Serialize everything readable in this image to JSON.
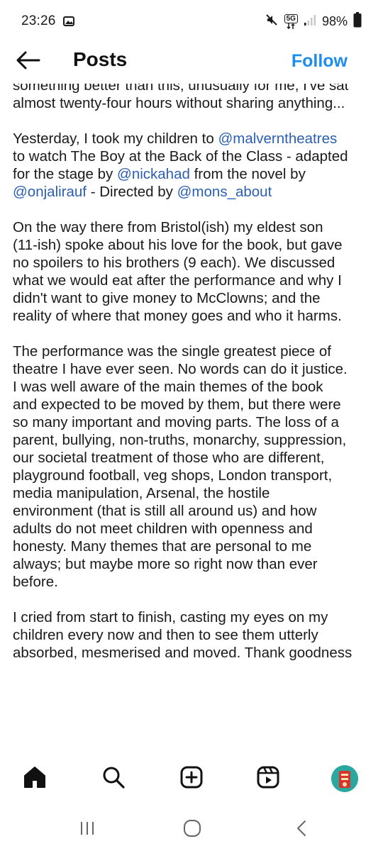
{
  "status_bar": {
    "time": "23:26",
    "battery": "98%",
    "network": "5G",
    "icons": [
      "gallery-icon",
      "mute-icon",
      "network-5g-icon",
      "signal-icon",
      "battery-icon"
    ]
  },
  "header": {
    "title": "Posts",
    "follow_label": "Follow",
    "back_icon": "arrow-left-icon",
    "accent_color": "#1d8ef0"
  },
  "post": {
    "mention_color": "#2b5fb4",
    "paragraphs": [
      {
        "lines": [
          [
            {
              "t": "something better than this; unusually for me, I've sat"
            }
          ],
          [
            {
              "t": "almost twenty-four hours without sharing anything..."
            }
          ]
        ]
      },
      {
        "lines": [
          [
            {
              "t": "Yesterday, I took my children to "
            },
            {
              "t": "@malverntheatres",
              "m": true
            }
          ],
          [
            {
              "t": "to watch The Boy at the Back of the Class - adapted"
            }
          ],
          [
            {
              "t": "for the stage by "
            },
            {
              "t": "@nickahad",
              "m": true
            },
            {
              "t": " from the novel by"
            }
          ],
          [
            {
              "t": "@onjalirauf",
              "m": true
            },
            {
              "t": " - Directed by "
            },
            {
              "t": "@mons_about",
              "m": true
            }
          ]
        ]
      },
      {
        "lines": [
          [
            {
              "t": "On the way there from Bristol(ish) my eldest son"
            }
          ],
          [
            {
              "t": "(11-ish) spoke about his love for the book, but gave"
            }
          ],
          [
            {
              "t": "no spoilers to his brothers (9 each). We discussed"
            }
          ],
          [
            {
              "t": "what we would eat after the performance and why I"
            }
          ],
          [
            {
              "t": "didn't want to give money to McClowns; and the"
            }
          ],
          [
            {
              "t": "reality of where that money goes and who it harms."
            }
          ]
        ]
      },
      {
        "lines": [
          [
            {
              "t": "The performance was the single greatest piece of"
            }
          ],
          [
            {
              "t": "theatre I have ever seen. No words can do it justice."
            }
          ],
          [
            {
              "t": "I was well aware of the main themes of the book"
            }
          ],
          [
            {
              "t": "and expected to be moved by them, but there were"
            }
          ],
          [
            {
              "t": "so many important and moving parts. The loss of a"
            }
          ],
          [
            {
              "t": "parent, bullying, non-truths, monarchy, suppression,"
            }
          ],
          [
            {
              "t": "our societal treatment of those who are different,"
            }
          ],
          [
            {
              "t": "playground football, veg shops, London transport,"
            }
          ],
          [
            {
              "t": "media manipulation, Arsenal, the hostile"
            }
          ],
          [
            {
              "t": "environment (that is still all around us) and how"
            }
          ],
          [
            {
              "t": "adults do not meet children with openness and"
            }
          ],
          [
            {
              "t": "honesty. Many themes that are personal to me"
            }
          ],
          [
            {
              "t": "always; but maybe more so right now than ever"
            }
          ],
          [
            {
              "t": "before."
            }
          ]
        ]
      },
      {
        "lines": [
          [
            {
              "t": "I cried from start to finish, casting my eyes on my"
            }
          ],
          [
            {
              "t": "children every now and then to see them utterly"
            }
          ],
          [
            {
              "t": "absorbed, mesmerised and moved. Thank goodness"
            }
          ]
        ]
      }
    ]
  },
  "bottom_nav": {
    "items": [
      {
        "name": "home",
        "icon": "home-icon",
        "active": true
      },
      {
        "name": "search",
        "icon": "search-icon",
        "active": false
      },
      {
        "name": "create",
        "icon": "add-post-icon",
        "active": false
      },
      {
        "name": "reels",
        "icon": "reels-icon",
        "active": false
      },
      {
        "name": "profile",
        "icon": "profile-avatar-icon",
        "active": false
      }
    ]
  },
  "system_nav": {
    "icons": [
      "recent-apps-icon",
      "home-circle-icon",
      "back-chevron-icon"
    ]
  }
}
